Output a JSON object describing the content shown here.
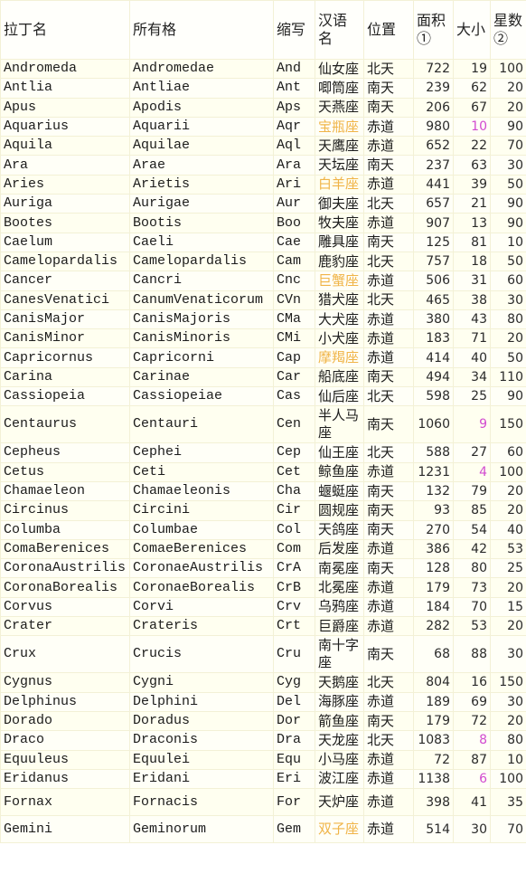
{
  "table": {
    "headers": {
      "latin": "拉丁名",
      "genitive": "所有格",
      "abbr": "缩写",
      "chinese": "汉语名",
      "position": "位置",
      "area": "面积①",
      "size_rank": "大小",
      "star_count": "星数②"
    },
    "colors": {
      "zodiac_text": "#f0b448",
      "top_size_text": "#d24ad0"
    },
    "rows": [
      {
        "latin": "Andromeda",
        "genitive": "Andromedae",
        "abbr": "And",
        "chinese": "仙女座",
        "position": "北天",
        "area": "722",
        "size": "19",
        "stars": "100",
        "zodiac": false,
        "top": false
      },
      {
        "latin": "Antlia",
        "genitive": "Antliae",
        "abbr": "Ant",
        "chinese": "唧筒座",
        "position": "南天",
        "area": "239",
        "size": "62",
        "stars": "20",
        "zodiac": false,
        "top": false
      },
      {
        "latin": "Apus",
        "genitive": "Apodis",
        "abbr": "Aps",
        "chinese": "天燕座",
        "position": "南天",
        "area": "206",
        "size": "67",
        "stars": "20",
        "zodiac": false,
        "top": false
      },
      {
        "latin": "Aquarius",
        "genitive": "Aquarii",
        "abbr": "Aqr",
        "chinese": "宝瓶座",
        "position": "赤道",
        "area": "980",
        "size": "10",
        "stars": "90",
        "zodiac": true,
        "top": true
      },
      {
        "latin": "Aquila",
        "genitive": "Aquilae",
        "abbr": "Aql",
        "chinese": "天鹰座",
        "position": "赤道",
        "area": "652",
        "size": "22",
        "stars": "70",
        "zodiac": false,
        "top": false
      },
      {
        "latin": "Ara",
        "genitive": "Arae",
        "abbr": "Ara",
        "chinese": "天坛座",
        "position": "南天",
        "area": "237",
        "size": "63",
        "stars": "30",
        "zodiac": false,
        "top": false
      },
      {
        "latin": "Aries",
        "genitive": "Arietis",
        "abbr": "Ari",
        "chinese": "白羊座",
        "position": "赤道",
        "area": "441",
        "size": "39",
        "stars": "50",
        "zodiac": true,
        "top": false
      },
      {
        "latin": "Auriga",
        "genitive": "Aurigae",
        "abbr": "Aur",
        "chinese": "御夫座",
        "position": "北天",
        "area": "657",
        "size": "21",
        "stars": "90",
        "zodiac": false,
        "top": false
      },
      {
        "latin": "Bootes",
        "genitive": "Bootis",
        "abbr": "Boo",
        "chinese": "牧夫座",
        "position": "赤道",
        "area": "907",
        "size": "13",
        "stars": "90",
        "zodiac": false,
        "top": false
      },
      {
        "latin": "Caelum",
        "genitive": "Caeli",
        "abbr": "Cae",
        "chinese": "雕具座",
        "position": "南天",
        "area": "125",
        "size": "81",
        "stars": "10",
        "zodiac": false,
        "top": false
      },
      {
        "latin": "Camelopardalis",
        "genitive": "Camelopardalis",
        "abbr": "Cam",
        "chinese": "鹿豹座",
        "position": "北天",
        "area": "757",
        "size": "18",
        "stars": "50",
        "zodiac": false,
        "top": false
      },
      {
        "latin": "Cancer",
        "genitive": "Cancri",
        "abbr": "Cnc",
        "chinese": "巨蟹座",
        "position": "赤道",
        "area": "506",
        "size": "31",
        "stars": "60",
        "zodiac": true,
        "top": false
      },
      {
        "latin": "CanesVenatici",
        "genitive": "CanumVenaticorum",
        "abbr": "CVn",
        "chinese": "猎犬座",
        "position": "北天",
        "area": "465",
        "size": "38",
        "stars": "30",
        "zodiac": false,
        "top": false
      },
      {
        "latin": "CanisMajor",
        "genitive": "CanisMajoris",
        "abbr": "CMa",
        "chinese": "大犬座",
        "position": "赤道",
        "area": "380",
        "size": "43",
        "stars": "80",
        "zodiac": false,
        "top": false
      },
      {
        "latin": "CanisMinor",
        "genitive": "CanisMinoris",
        "abbr": "CMi",
        "chinese": "小犬座",
        "position": "赤道",
        "area": "183",
        "size": "71",
        "stars": "20",
        "zodiac": false,
        "top": false
      },
      {
        "latin": "Capricornus",
        "genitive": "Capricorni",
        "abbr": "Cap",
        "chinese": "摩羯座",
        "position": "赤道",
        "area": "414",
        "size": "40",
        "stars": "50",
        "zodiac": true,
        "top": false
      },
      {
        "latin": "Carina",
        "genitive": "Carinae",
        "abbr": "Car",
        "chinese": "船底座",
        "position": "南天",
        "area": "494",
        "size": "34",
        "stars": "110",
        "zodiac": false,
        "top": false
      },
      {
        "latin": "Cassiopeia",
        "genitive": "Cassiopeiae",
        "abbr": "Cas",
        "chinese": "仙后座",
        "position": "北天",
        "area": "598",
        "size": "25",
        "stars": "90",
        "zodiac": false,
        "top": false
      },
      {
        "latin": "Centaurus",
        "genitive": "Centauri",
        "abbr": "Cen",
        "chinese": "半人马座",
        "position": "南天",
        "area": "1060",
        "size": "9",
        "stars": "150",
        "zodiac": false,
        "top": true,
        "tall": true
      },
      {
        "latin": "Cepheus",
        "genitive": "Cephei",
        "abbr": "Cep",
        "chinese": "仙王座",
        "position": "北天",
        "area": "588",
        "size": "27",
        "stars": "60",
        "zodiac": false,
        "top": false
      },
      {
        "latin": "Cetus",
        "genitive": "Ceti",
        "abbr": "Cet",
        "chinese": "鲸鱼座",
        "position": "赤道",
        "area": "1231",
        "size": "4",
        "stars": "100",
        "zodiac": false,
        "top": true
      },
      {
        "latin": "Chamaeleon",
        "genitive": "Chamaeleonis",
        "abbr": "Cha",
        "chinese": "蝘蜓座",
        "position": "南天",
        "area": "132",
        "size": "79",
        "stars": "20",
        "zodiac": false,
        "top": false
      },
      {
        "latin": "Circinus",
        "genitive": "Circini",
        "abbr": "Cir",
        "chinese": "圆规座",
        "position": "南天",
        "area": "93",
        "size": "85",
        "stars": "20",
        "zodiac": false,
        "top": false
      },
      {
        "latin": "Columba",
        "genitive": "Columbae",
        "abbr": "Col",
        "chinese": "天鸽座",
        "position": "南天",
        "area": "270",
        "size": "54",
        "stars": "40",
        "zodiac": false,
        "top": false
      },
      {
        "latin": "ComaBerenices",
        "genitive": "ComaeBerenices",
        "abbr": "Com",
        "chinese": "后发座",
        "position": "赤道",
        "area": "386",
        "size": "42",
        "stars": "53",
        "zodiac": false,
        "top": false
      },
      {
        "latin": "CoronaAustrilis",
        "genitive": "CoronaeAustrilis",
        "abbr": "CrA",
        "chinese": "南冕座",
        "position": "南天",
        "area": "128",
        "size": "80",
        "stars": "25",
        "zodiac": false,
        "top": false
      },
      {
        "latin": "CoronaBorealis",
        "genitive": "CoronaeBorealis",
        "abbr": "CrB",
        "chinese": "北冕座",
        "position": "赤道",
        "area": "179",
        "size": "73",
        "stars": "20",
        "zodiac": false,
        "top": false
      },
      {
        "latin": "Corvus",
        "genitive": "Corvi",
        "abbr": "Crv",
        "chinese": "乌鸦座",
        "position": "赤道",
        "area": "184",
        "size": "70",
        "stars": "15",
        "zodiac": false,
        "top": false
      },
      {
        "latin": "Crater",
        "genitive": "Crateris",
        "abbr": "Crt",
        "chinese": "巨爵座",
        "position": "赤道",
        "area": "282",
        "size": "53",
        "stars": "20",
        "zodiac": false,
        "top": false
      },
      {
        "latin": "Crux",
        "genitive": "Crucis",
        "abbr": "Cru",
        "chinese": "南十字座",
        "position": "南天",
        "area": "68",
        "size": "88",
        "stars": "30",
        "zodiac": false,
        "top": false,
        "tall": true
      },
      {
        "latin": "Cygnus",
        "genitive": "Cygni",
        "abbr": "Cyg",
        "chinese": "天鹅座",
        "position": "北天",
        "area": "804",
        "size": "16",
        "stars": "150",
        "zodiac": false,
        "top": false
      },
      {
        "latin": "Delphinus",
        "genitive": "Delphini",
        "abbr": "Del",
        "chinese": "海豚座",
        "position": "赤道",
        "area": "189",
        "size": "69",
        "stars": "30",
        "zodiac": false,
        "top": false
      },
      {
        "latin": "Dorado",
        "genitive": "Doradus",
        "abbr": "Dor",
        "chinese": "箭鱼座",
        "position": "南天",
        "area": "179",
        "size": "72",
        "stars": "20",
        "zodiac": false,
        "top": false
      },
      {
        "latin": "Draco",
        "genitive": "Draconis",
        "abbr": "Dra",
        "chinese": "天龙座",
        "position": "北天",
        "area": "1083",
        "size": "8",
        "stars": "80",
        "zodiac": false,
        "top": true
      },
      {
        "latin": "Equuleus",
        "genitive": "Equulei",
        "abbr": "Equ",
        "chinese": "小马座",
        "position": "赤道",
        "area": "72",
        "size": "87",
        "stars": "10",
        "zodiac": false,
        "top": false
      },
      {
        "latin": "Eridanus",
        "genitive": "Eridani",
        "abbr": "Eri",
        "chinese": "波江座",
        "position": "赤道",
        "area": "1138",
        "size": "6",
        "stars": "100",
        "zodiac": false,
        "top": true
      },
      {
        "latin": "Fornax",
        "genitive": "Fornacis",
        "abbr": "For",
        "chinese": "天炉座",
        "position": "赤道",
        "area": "398",
        "size": "41",
        "stars": "35",
        "zodiac": false,
        "top": false,
        "mid": true
      },
      {
        "latin": "Gemini",
        "genitive": "Geminorum",
        "abbr": "Gem",
        "chinese": "双子座",
        "position": "赤道",
        "area": "514",
        "size": "30",
        "stars": "70",
        "zodiac": true,
        "top": false,
        "mid": true
      }
    ]
  }
}
